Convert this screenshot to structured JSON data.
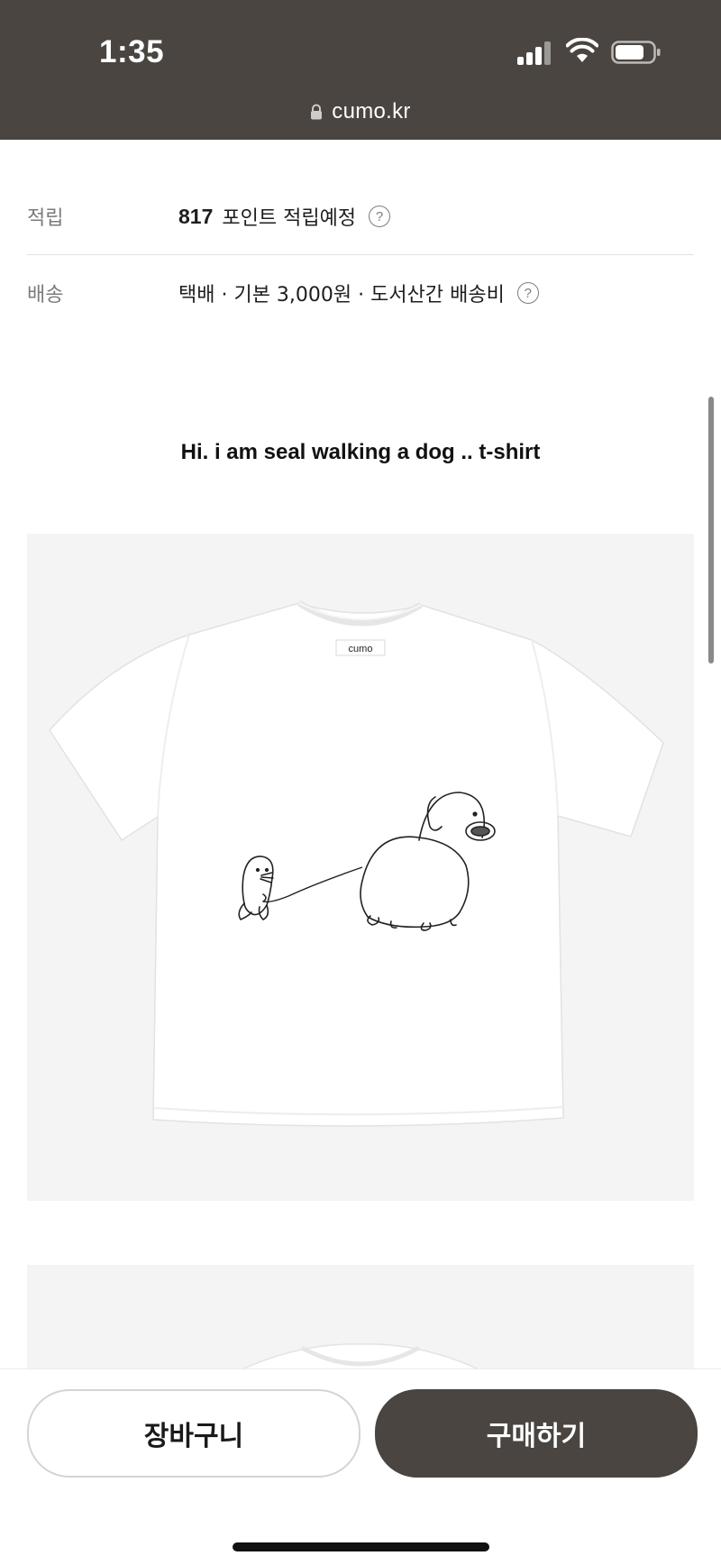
{
  "status_bar": {
    "time": "1:35"
  },
  "browser": {
    "url": "cumo.kr"
  },
  "info": {
    "reward": {
      "label": "적립",
      "points": "817",
      "text": "포인트 적립예정"
    },
    "shipping": {
      "label": "배송",
      "text": "택배 · 기본 3,000원 · 도서산간 배송비"
    }
  },
  "product": {
    "title": "Hi. i am seal walking a dog .. t-shirt",
    "tag_text": "cumo"
  },
  "actions": {
    "cart_label": "장바구니",
    "buy_label": "구매하기"
  },
  "colors": {
    "top_bar": "#4a4541",
    "buy_button": "#4a4541",
    "photo_bg": "#f4f4f4"
  }
}
